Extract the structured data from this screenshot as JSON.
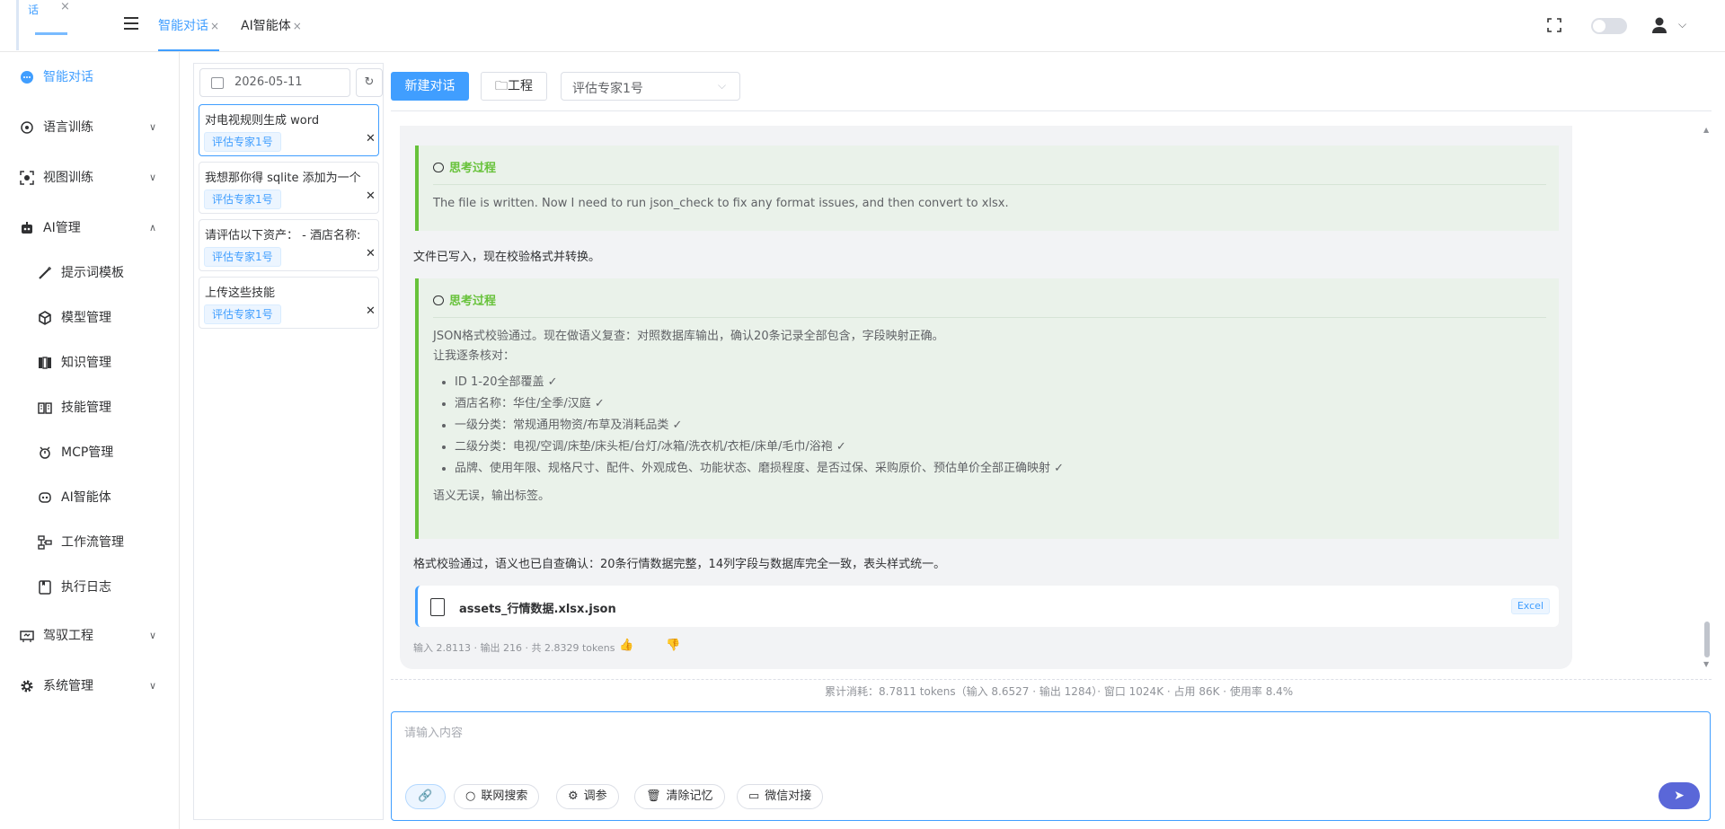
{
  "app": {
    "logo_text": "话",
    "logo_close": "×"
  },
  "tabs": [
    {
      "label": "智能对话",
      "close": "×"
    },
    {
      "label": "AI智能体",
      "close": "×"
    }
  ],
  "sidebar": {
    "items": [
      {
        "label": "智能对话",
        "icon": "chat-bubble-icon"
      },
      {
        "label": "语言训练",
        "icon": "language-icon",
        "chevron": "∨"
      },
      {
        "label": "视图训练",
        "icon": "vision-icon",
        "chevron": "∨"
      },
      {
        "label": "AI管理",
        "icon": "robot-icon",
        "chevron": "∧"
      },
      {
        "label": "驾驭工程",
        "icon": "engineering-icon",
        "chevron": "∨"
      },
      {
        "label": "系统管理",
        "icon": "gear-icon",
        "chevron": "∨"
      }
    ],
    "ai_sub": [
      {
        "label": "提示词模板",
        "icon": "magic-wand-icon"
      },
      {
        "label": "模型管理",
        "icon": "cube-icon"
      },
      {
        "label": "知识管理",
        "icon": "book-icon"
      },
      {
        "label": "技能管理",
        "icon": "skill-book-icon"
      },
      {
        "label": "MCP管理",
        "icon": "mcp-icon"
      },
      {
        "label": "AI智能体",
        "icon": "agent-icon"
      },
      {
        "label": "工作流管理",
        "icon": "workflow-icon"
      },
      {
        "label": "执行日志",
        "icon": "log-icon"
      }
    ]
  },
  "history": {
    "date": "2026-05-11",
    "refresh": "↻",
    "conversations": [
      {
        "title": "对电视规则生成 word",
        "tag": "评估专家1号",
        "delete": "✕"
      },
      {
        "title": "我想那你得 sqlite 添加为一个",
        "tag": "评估专家1号",
        "delete": "✕"
      },
      {
        "title": "请评估以下资产：  - 酒店名称:",
        "tag": "评估专家1号",
        "delete": "✕"
      },
      {
        "title": "上传这些技能",
        "tag": "评估专家1号",
        "delete": "✕"
      }
    ]
  },
  "toolbar": {
    "new_chat": "新建对话",
    "project": "工程",
    "agent_select": "评估专家1号",
    "agent_arrow": "⌵"
  },
  "chat": {
    "think1": {
      "header": "思考过程",
      "text": "The file is written. Now I need to run json_check to fix any format issues, and then convert to xlsx."
    },
    "msg1": "文件已写入，现在校验格式并转换。",
    "think2": {
      "header": "思考过程",
      "line1": "JSON格式校验通过。现在做语义复查：对照数据库输出，确认20条记录全部包含，字段映射正确。",
      "line2": "让我逐条核对：",
      "bullets": [
        "ID 1-20全部覆盖 ✓",
        "酒店名称：华住/全季/汉庭 ✓",
        "一级分类：常规通用物资/布草及消耗品类 ✓",
        "二级分类：电视/空调/床垫/床头柜/台灯/冰箱/洗衣机/衣柜/床单/毛巾/浴袍 ✓",
        "品牌、使用年限、规格尺寸、配件、外观成色、功能状态、磨损程度、是否过保、采购原价、预估单价全部正确映射 ✓"
      ],
      "closing": "语义无误，输出标签。"
    },
    "msg2": "格式校验通过，语义也已自查确认：20条行情数据完整，14列字段与数据库完全一致，表头样式统一。",
    "file": {
      "name": "assets_行情数据.xlsx.json",
      "badge": "Excel"
    },
    "usage": "输入 2.8113 · 输出 216 · 共 2.8329 tokens",
    "like": "👍",
    "dislike": "👎"
  },
  "stats": "累计消耗：8.7811 tokens（输入 8.6527 · 输出 1284）· 窗口 1024K · 占用 86K · 使用率 8.4%",
  "input": {
    "placeholder": "请输入内容",
    "attach": "🔗",
    "web_search": "联网搜索",
    "params": "调参",
    "clear_memory": "清除记忆",
    "wechat": "微信对接",
    "send": "➤"
  },
  "colors": {
    "accent": "#409eff",
    "think_border": "#67c23a",
    "send": "#5a67d8"
  }
}
